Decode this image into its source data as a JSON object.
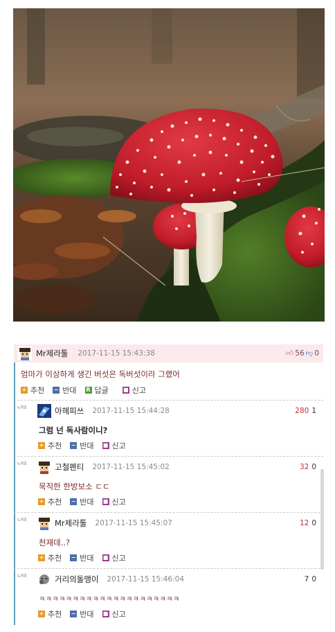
{
  "photo": {
    "alt": ""
  },
  "main_comment": {
    "nickname": "Mr제라툴",
    "date": "2017-11-15 15:43:38",
    "upvotes": "56",
    "downvotes": "0",
    "text": "엄마가 이상하게 생긴 버섯은 독버섯이라 그랬어",
    "actions": {
      "recommend": "추천",
      "oppose": "반대",
      "reply": "답글",
      "report": "신고"
    }
  },
  "replies": [
    {
      "nickname": "아헤피쓰",
      "date": "2017-11-15 15:44:28",
      "upvotes": "280",
      "downvotes": "1",
      "text": "그럼 넌 독사람이니?",
      "bold": true
    },
    {
      "nickname": "고철팬티",
      "date": "2017-11-15 15:45:02",
      "upvotes": "32",
      "downvotes": "0",
      "text": "묵직한 한방보소 ㄷㄷ",
      "bold": false
    },
    {
      "nickname": "Mr제라툴",
      "date": "2017-11-15 15:45:07",
      "upvotes": "12",
      "downvotes": "0",
      "text": "천재데..?",
      "bold": false
    },
    {
      "nickname": "거리의돌맹이",
      "date": "2017-11-15 15:46:04",
      "upvotes": "7",
      "downvotes": "0",
      "text": "ㅋㅋㅋㅋㅋㅋㅋㅋㅋㅋㅋㅋㅋㅋㅋㅋㅋㅋㅋㅋㅋ",
      "bold": false
    }
  ],
  "reply_actions": {
    "recommend": "추천",
    "oppose": "반대",
    "report": "신고"
  },
  "re_label": "RE",
  "colors": {
    "header_bg": "#fbe9ec",
    "accent_bar": "#5aa2b9",
    "cap_red": "#c8202e"
  },
  "icons": [
    "pixel-avatar-icon",
    "thumbs-up-icon",
    "thumbs-down-icon",
    "reply-arrow-icon"
  ]
}
